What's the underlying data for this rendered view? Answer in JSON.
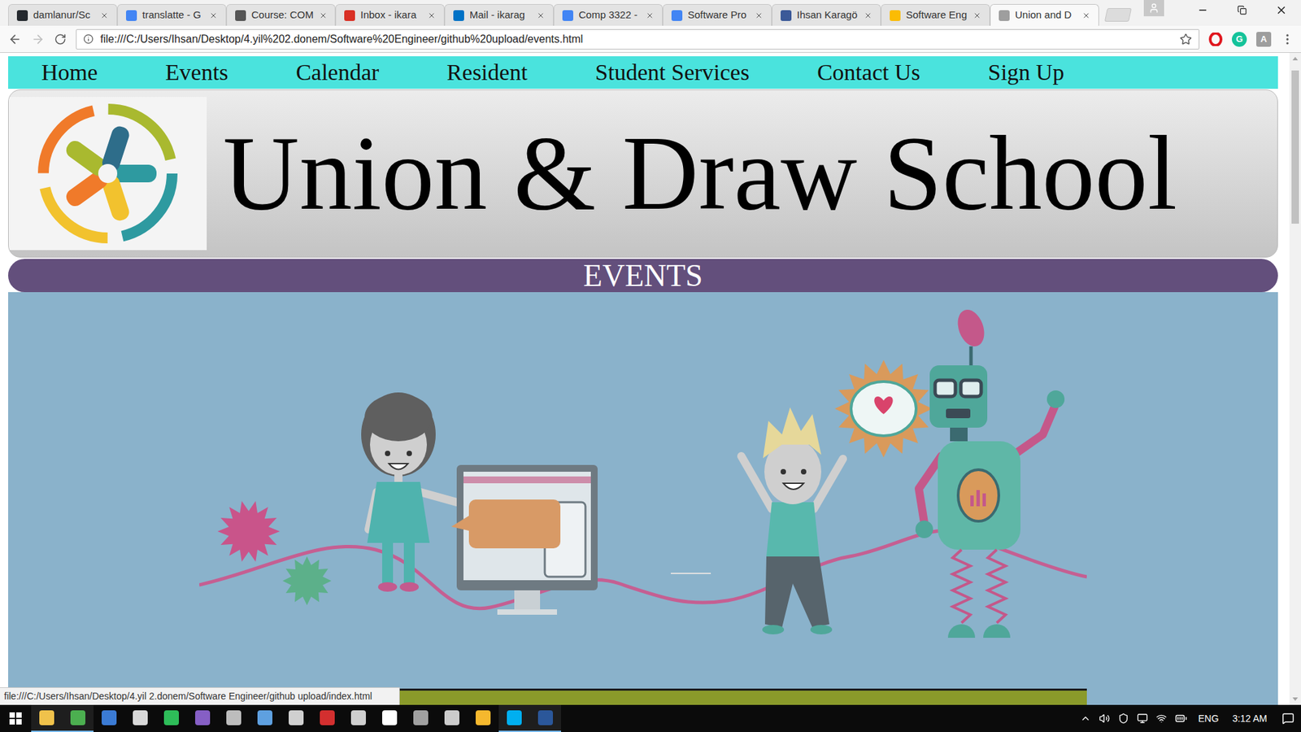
{
  "browser": {
    "tabs": [
      {
        "label": "damlanur/Sc",
        "selected": false,
        "color": "#24292e"
      },
      {
        "label": "translatte - G",
        "selected": false,
        "color": "#4285f4"
      },
      {
        "label": "Course: COM",
        "selected": false,
        "color": "#555555"
      },
      {
        "label": "Inbox - ikara",
        "selected": false,
        "color": "#d93025"
      },
      {
        "label": "Mail - ikarag",
        "selected": false,
        "color": "#0072c6"
      },
      {
        "label": "Comp 3322 -",
        "selected": false,
        "color": "#4285f4"
      },
      {
        "label": "Software Pro",
        "selected": false,
        "color": "#4285f4"
      },
      {
        "label": "Ihsan Karagö",
        "selected": false,
        "color": "#3b5998"
      },
      {
        "label": "Software Eng",
        "selected": false,
        "color": "#fbbc04"
      },
      {
        "label": "Union and D",
        "selected": true,
        "color": "#9e9e9e"
      }
    ],
    "address": "file:///C:/Users/Ihsan/Desktop/4.yil%202.donem/Software%20Engineer/github%20upload/events.html",
    "extensions": [
      {
        "label": "G",
        "color": "#15c39a"
      },
      {
        "label": "A",
        "color": "#9e9e9e"
      }
    ]
  },
  "page": {
    "nav": [
      "Home",
      "Events",
      "Calendar",
      "Resident",
      "Student Services",
      "Contact Us",
      "Sign Up"
    ],
    "school_name": "Union & Draw School",
    "section_title": "EVENTS"
  },
  "status_bar": "file:///C:/Users/Ihsan/Desktop/4.yil 2.donem/Software Engineer/github upload/index.html",
  "taskbar": {
    "apps": [
      {
        "color": "#f0c24b",
        "selected": true
      },
      {
        "color": "#4caf50",
        "selected": true
      },
      {
        "color": "#3b7bd4",
        "selected": false
      },
      {
        "color": "#d8d8d8",
        "selected": false
      },
      {
        "color": "#2ebd59",
        "selected": false
      },
      {
        "color": "#865fc5",
        "selected": false
      },
      {
        "color": "#bdbdbd",
        "selected": false
      },
      {
        "color": "#5ea0e0",
        "selected": false
      },
      {
        "color": "#d0d0d0",
        "selected": false
      },
      {
        "color": "#d32f2f",
        "selected": false
      },
      {
        "color": "#cfcfcf",
        "selected": false
      },
      {
        "color": "#ffffff",
        "selected": false
      },
      {
        "color": "#a0a0a0",
        "selected": false
      },
      {
        "color": "#cccccc",
        "selected": false
      },
      {
        "color": "#f5b82e",
        "selected": false
      },
      {
        "color": "#00aff0",
        "selected": true
      },
      {
        "color": "#2b579a",
        "selected": true
      }
    ],
    "language": "ENG",
    "time": "3:12 AM"
  }
}
